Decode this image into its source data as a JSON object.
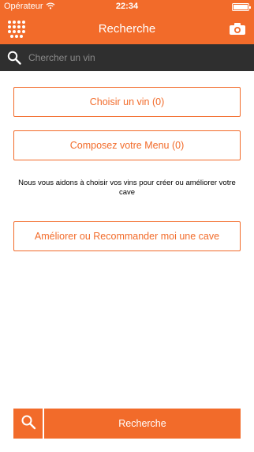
{
  "status_bar": {
    "carrier": "Opérateur",
    "time": "22:34"
  },
  "navbar": {
    "title": "Recherche"
  },
  "search": {
    "placeholder": "Chercher un vin"
  },
  "main": {
    "choose_wine_button": "Choisir un vin (0)",
    "compose_menu_button": "Composez votre Menu (0)",
    "info_text": "Nous vous aidons à choisir vos vins pour créer ou améliorer votre cave",
    "improve_cellar_button": "Améliorer ou Recommander moi une cave"
  },
  "bottom": {
    "search_button": "Recherche"
  },
  "colors": {
    "accent": "#f26b2a",
    "search_bar": "#2f2f2f",
    "background": "#ffffff"
  },
  "icons": [
    "grid-icon",
    "camera-icon",
    "search-icon",
    "wifi-icon",
    "battery-icon"
  ]
}
